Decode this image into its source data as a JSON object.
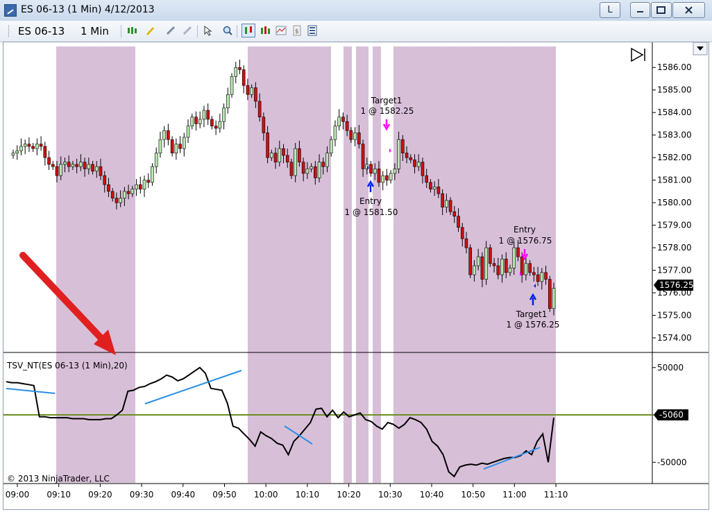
{
  "window": {
    "title": "ES 06-13 (1 Min)  4/12/2013",
    "link_button": "L"
  },
  "toolbar": {
    "instrument": "ES 06-13",
    "interval": "1 Min",
    "icons": [
      "bar-style-icon",
      "drawing-pencil-icon",
      "zoom-in-icon",
      "zoom-out-icon",
      "cursor-icon",
      "magnify-icon",
      "chart-trader-icon",
      "strategies-icon",
      "indicators-icon",
      "data-box-icon",
      "properties-icon"
    ]
  },
  "colors": {
    "session_shade": "#d8bfd8",
    "up_candle": "#b8e6b0",
    "down_candle": "#cc1111",
    "indicator_line": "#000000",
    "zero_line": "#6b8e23",
    "trend_line": "#2b8fe8",
    "arrow_marker": "#e02020",
    "target_arrow": "#ff00ff",
    "entry_arrow": "#0022ee"
  },
  "panels": {
    "price_label": "1576.25",
    "indicator_label": "TSV_NT(ES 06-13 (1 Min),20)",
    "indicator_value": "-5060",
    "copyright": "© 2013 NinjaTrader, LLC"
  },
  "annotations": [
    {
      "line1": "Target1",
      "line2": "1 @ 1582.25"
    },
    {
      "line1": "Entry",
      "line2": "1 @ 1581.50"
    },
    {
      "line1": "Entry",
      "line2": "1 @ 1576.75"
    },
    {
      "line1": "Target1",
      "line2": "1 @ 1576.25"
    }
  ],
  "chart_data": [
    {
      "type": "candlestick",
      "x_ticks": [
        "09:00",
        "09:10",
        "09:20",
        "09:30",
        "09:40",
        "09:50",
        "10:00",
        "10:10",
        "10:20",
        "10:30",
        "10:40",
        "10:50",
        "11:00",
        "11:10"
      ],
      "y_ticks": [
        "1586.00",
        "1585.00",
        "1584.00",
        "1583.00",
        "1582.00",
        "1581.00",
        "1580.00",
        "1579.00",
        "1578.00",
        "1577.00",
        "1576.00",
        "1575.00",
        "1574.00"
      ],
      "ylim": [
        1573.6,
        1586.9
      ],
      "close": [
        1582.2,
        1582.3,
        1582.5,
        1582.6,
        1582.5,
        1582.4,
        1582.6,
        1582.5,
        1582.0,
        1581.7,
        1581.6,
        1581.2,
        1581.7,
        1581.8,
        1581.6,
        1581.7,
        1581.6,
        1581.8,
        1581.5,
        1581.7,
        1581.4,
        1581.6,
        1581.2,
        1580.8,
        1580.5,
        1580.2,
        1580.0,
        1580.2,
        1580.5,
        1580.4,
        1580.6,
        1580.8,
        1580.6,
        1581.0,
        1580.9,
        1581.6,
        1582.2,
        1582.8,
        1583.2,
        1582.8,
        1582.2,
        1582.6,
        1582.4,
        1582.9,
        1583.4,
        1583.8,
        1583.5,
        1583.7,
        1584.1,
        1583.7,
        1583.4,
        1583.3,
        1583.6,
        1584.2,
        1584.8,
        1585.6,
        1586.0,
        1585.9,
        1585.2,
        1584.8,
        1585.1,
        1584.5,
        1583.8,
        1583.1,
        1582.0,
        1582.2,
        1581.8,
        1582.4,
        1582.1,
        1581.8,
        1581.2,
        1582.4,
        1581.8,
        1581.3,
        1581.5,
        1581.6,
        1581.1,
        1581.8,
        1581.6,
        1582.2,
        1582.8,
        1583.4,
        1583.8,
        1583.6,
        1583.2,
        1582.8,
        1583.1,
        1582.6,
        1581.5,
        1581.7,
        1581.3,
        1581.5,
        1580.9,
        1581.2,
        1581.0,
        1581.3,
        1581.5,
        1582.8,
        1582.2,
        1582.0,
        1581.9,
        1581.6,
        1581.8,
        1581.2,
        1580.9,
        1580.6,
        1580.7,
        1580.4,
        1579.8,
        1580.1,
        1579.6,
        1579.4,
        1578.9,
        1578.4,
        1578.0,
        1576.8,
        1577.2,
        1577.6,
        1576.6,
        1578.0,
        1577.3,
        1577.2,
        1576.8,
        1577.5,
        1576.9,
        1577.1,
        1578.0,
        1577.6,
        1576.8,
        1577.3,
        1576.9,
        1576.8,
        1576.5,
        1576.9,
        1576.6,
        1575.3,
        1576.2
      ]
    },
    {
      "type": "line",
      "title": "TSV_NT(ES 06-13 (1 Min),20)",
      "y_ticks": [
        "50000",
        "0",
        "-50000"
      ],
      "ylim": [
        -71000,
        63000
      ],
      "values": [
        35000,
        34000,
        34000,
        33000,
        32000,
        31000,
        -2000,
        -2000,
        -3000,
        -3000,
        -3000,
        -3000,
        -4000,
        -4000,
        -4000,
        -5000,
        -5000,
        -5000,
        -4000,
        -4000,
        0,
        5000,
        25000,
        26000,
        29000,
        30000,
        33000,
        35000,
        38000,
        42000,
        40000,
        36000,
        38000,
        42000,
        46000,
        50000,
        44000,
        28000,
        27000,
        26000,
        12000,
        -12000,
        -14000,
        -20000,
        -26000,
        -33000,
        -18000,
        -22000,
        -25000,
        -30000,
        -32000,
        -42000,
        -28000,
        -22000,
        -15000,
        -8000,
        6000,
        7000,
        -2000,
        5000,
        -3000,
        3000,
        -2000,
        0,
        2000,
        -5000,
        -7000,
        -12000,
        -15000,
        -8000,
        -10000,
        -14000,
        -10000,
        -3000,
        -5000,
        -8000,
        -15000,
        -28000,
        -33000,
        -42000,
        -60000,
        -65000,
        -55000,
        -53000,
        -52000,
        -53000,
        -51000,
        -52000,
        -50000,
        -48000,
        -46000,
        -45000,
        -45000,
        -43000,
        -38000,
        -42000,
        -28000,
        -20000,
        -50000,
        -3000
      ]
    }
  ]
}
